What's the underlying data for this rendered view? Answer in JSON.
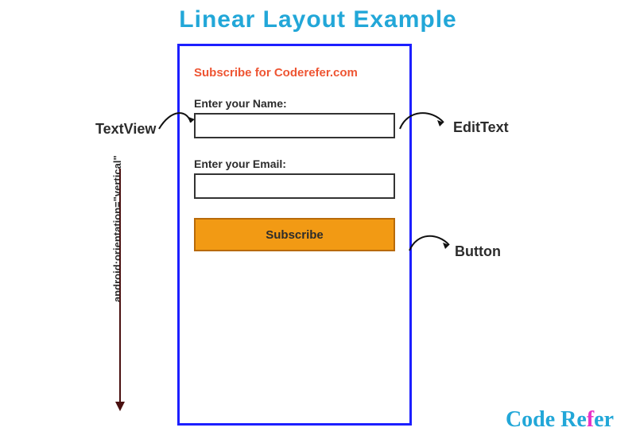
{
  "title": "Linear Layout Example",
  "form": {
    "heading": "Subscribe for Coderefer.com",
    "name_label": "Enter your Name:",
    "email_label": "Enter your Email:",
    "button_label": "Subscribe"
  },
  "annotations": {
    "textview": "TextView",
    "edittext": "EditText",
    "button": "Button",
    "orientation": "android:orientation=\"vertical\""
  },
  "logo": {
    "part1": "Code Re",
    "part2": "f",
    "part3": "er"
  }
}
